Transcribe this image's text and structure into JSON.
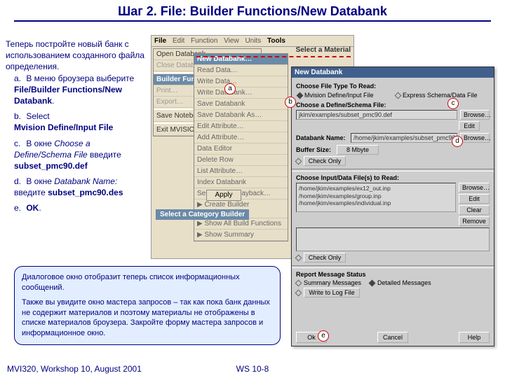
{
  "title": "Шаг 2. File:  Builder Functions/New Databank",
  "intro": "Теперь постройте новый банк с использованием созданного файла определения.",
  "steps": {
    "a": {
      "label": "a.",
      "pre": "В меню броузера выберите  ",
      "bold": "File/Builder Functions/New Databank",
      "post": "."
    },
    "b": {
      "label": "b.",
      "pre": "Select",
      "bold": "Mvision Define/Input File"
    },
    "c": {
      "label": "c.",
      "pre": "В окне ",
      "ital": "Choose a Define/Schema File",
      "mid": " введите ",
      "bold": "subset_pmc90.def"
    },
    "d": {
      "label": "d.",
      "pre": "В окне ",
      "ital": "Databank Name:",
      "mid": " введите ",
      "bold": "subset_pmc90.des"
    },
    "e": {
      "label": "e.",
      "bold": "OK",
      "post": "."
    }
  },
  "callout": {
    "p1": "Диалоговое окно отобразит теперь список информационных сообщений.",
    "p2": "Также вы увидите окно мастера запросов – так как пока банк данных не содержит материалов и поэтому материалы не отображены в списке материалов броузера. Закройте форму мастера запросов и информационное окно."
  },
  "footer": {
    "left": "MVI320, Workshop 10, August 2001",
    "center": "WS 10-8"
  },
  "menubar": {
    "file": "File",
    "edit": "Edit",
    "function": "Function",
    "view": "View",
    "units": "Units",
    "tools": "Tools"
  },
  "dropmenu": {
    "open": "Open Databank…",
    "close": "Close Databank…",
    "builder": "Builder Functions ▶",
    "print": "Print…",
    "export": "Export…",
    "save": "Save Notebook…",
    "exit": "Exit MVISION"
  },
  "submenu": {
    "new": "New Databank…",
    "read": "Read Data…",
    "writeData": "Write Data…",
    "writeDb": "Write Databank…",
    "saveDb": "Save Databank",
    "saveAs": "Save Databank As…",
    "editAttr": "Edit Attribute…",
    "addAttr": "Add Attribute…",
    "dataEd": "Data Editor",
    "delRow": "Delete Row",
    "listAttr": "List Attribute…",
    "indexDb": "Index Databank",
    "session": "SessionFile Playback…",
    "createB": "▶ Create Builder Function…",
    "showAll": "▶ Show All Build Functions",
    "showSum": "▶ Show Summary"
  },
  "browser": {
    "apply": "Apply",
    "cat": "Select a Category Builder",
    "mat": "Select a Material"
  },
  "dialog": {
    "title": "New Databank",
    "chooseType": "Choose File Type To Read:",
    "opt1": "Mvision Define/Input File",
    "opt2": "Express Schema/Data File",
    "chooseDef": "Choose a Define/Schema File:",
    "defVal": "jkim/examples/subset_pmc90.def",
    "dbName": "Databank Name:",
    "dbVal": "/home/jkim/examples/subset_pmc90.des",
    "buf": "Buffer Size:",
    "bufVal": "8 Mbyte",
    "checkOnly": "Check Only",
    "chooseInput": "Choose Input/Data File(s) to Read:",
    "f1": "/home/jkim/examples/ex12_out.inp",
    "f2": "/home/jkim/examples/group.inp",
    "f3": "/home/jkim/examples/individual.inp",
    "report": "Report Message Status",
    "sum": "Summary Messages",
    "det": "Detailed Messages",
    "log": "Write to Log File",
    "browse": "Browse…",
    "edit": "Edit",
    "clear": "Clear",
    "remove": "Remove",
    "ok": "Ok",
    "cancel": "Cancel",
    "help": "Help"
  },
  "markers": {
    "a": "a",
    "b": "b",
    "c": "c",
    "d": "d",
    "e": "e"
  }
}
